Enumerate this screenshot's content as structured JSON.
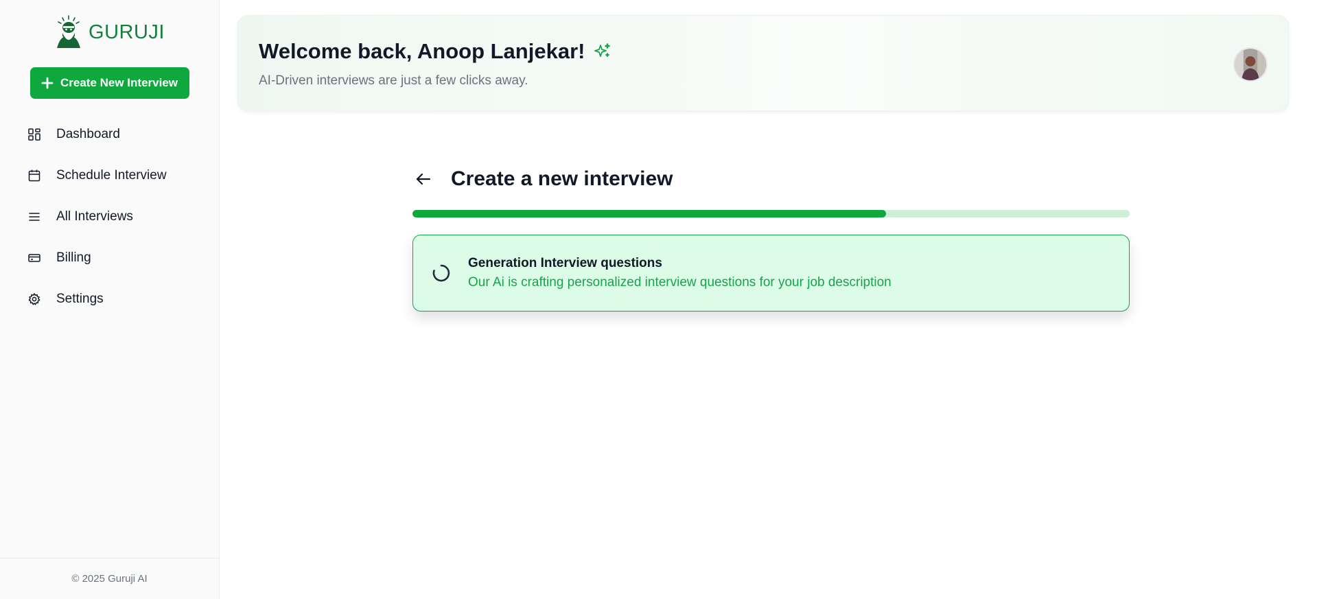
{
  "brand": {
    "name": "GURUJI"
  },
  "sidebar": {
    "create_button_label": "Create New Interview",
    "items": [
      {
        "label": "Dashboard",
        "icon": "dashboard-icon"
      },
      {
        "label": "Schedule Interview",
        "icon": "calendar-icon"
      },
      {
        "label": "All Interviews",
        "icon": "list-icon"
      },
      {
        "label": "Billing",
        "icon": "credit-card-icon"
      },
      {
        "label": "Settings",
        "icon": "gear-icon"
      }
    ],
    "footer": "© 2025 Guruji AI"
  },
  "header": {
    "welcome": "Welcome back, Anoop Lanjekar!",
    "subtitle": "AI-Driven interviews are just a few clicks away."
  },
  "page": {
    "title": "Create a new interview",
    "progress": 0.66
  },
  "status": {
    "title": "Generation Interview questions",
    "description": "Our Ai is crafting personalized interview questions for your job description"
  },
  "colors": {
    "accent": "#0fa83f",
    "brand_text": "#15803d",
    "card_bg": "#dcfce7",
    "card_text": "#16a34a"
  }
}
